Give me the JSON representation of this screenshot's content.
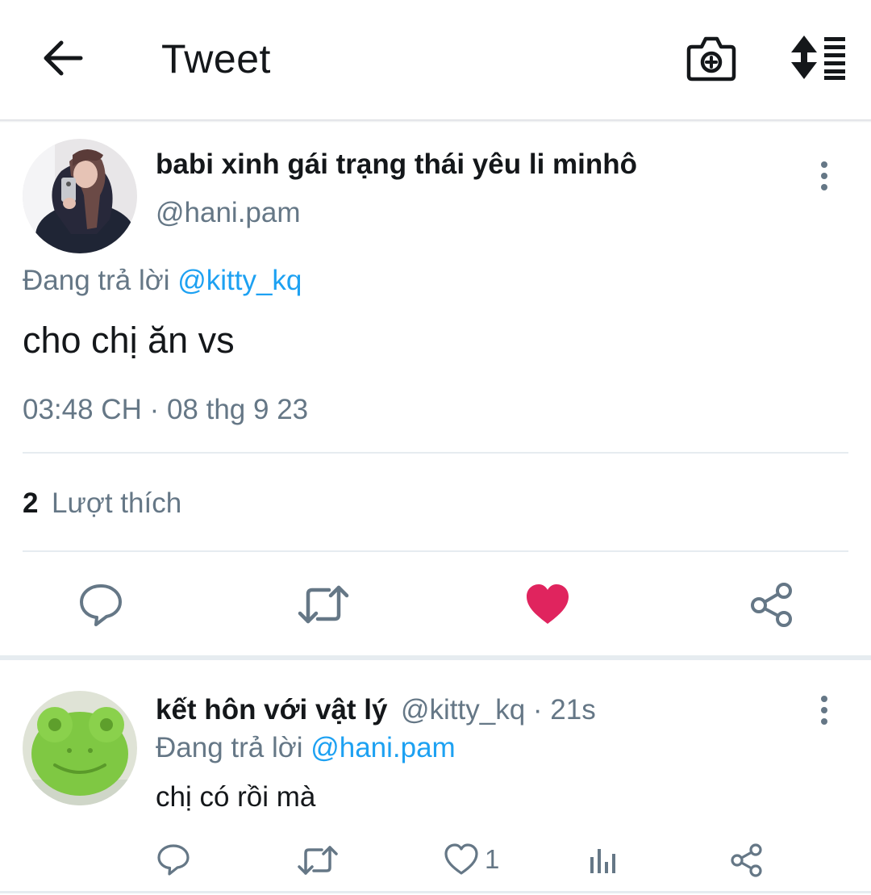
{
  "header": {
    "title": "Tweet",
    "back_icon": "arrow-left-icon",
    "camera_icon": "camera-add-icon",
    "sort_icon": "sort-list-icon"
  },
  "tweet": {
    "display_name": "babi xinh gái trạng thái yêu li minhô",
    "handle": "@hani.pam",
    "reply_prefix": "Đang trả lời",
    "reply_to": "@kitty_kq",
    "text": "cho chị ăn vs",
    "timestamp": "03:48 CH · 08 thg 9 23",
    "likes_count": "2",
    "likes_label": "Lượt thích",
    "liked": true,
    "like_color": "#e0245e"
  },
  "reply": {
    "display_name": "kết hôn với vật lý",
    "meta": "@kitty_kq · 21s",
    "reply_prefix": "Đang trả lời",
    "reply_to": "@hani.pam",
    "text": "chị có rồi mà",
    "like_count": "1"
  },
  "colors": {
    "text_primary": "#14171a",
    "text_secondary": "#657786",
    "link": "#1da1f2",
    "divider": "#e6ecf0"
  }
}
